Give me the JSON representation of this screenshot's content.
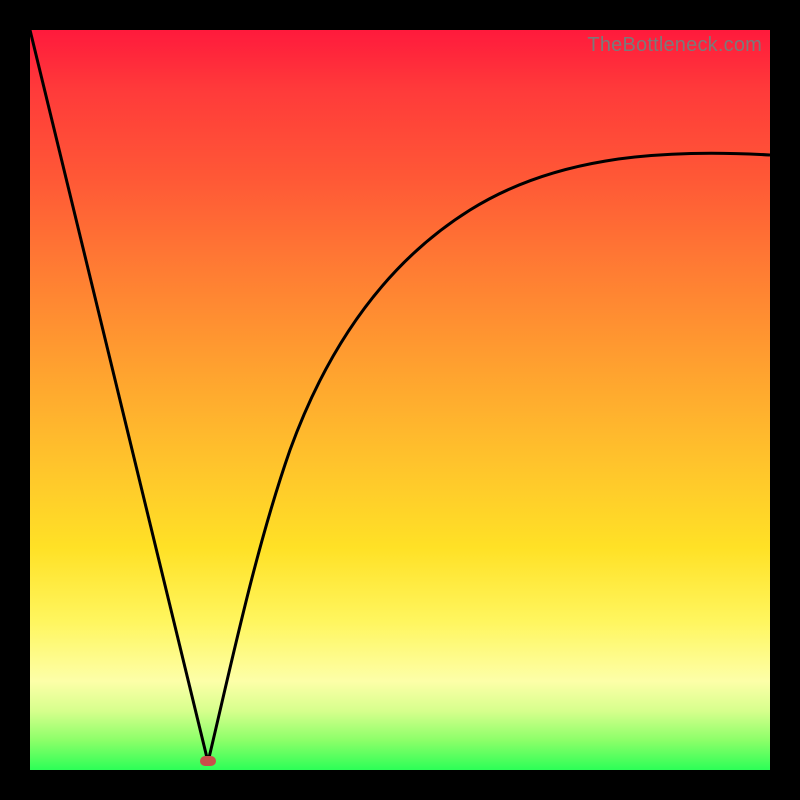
{
  "watermark": "TheBottleneck.com",
  "colors": {
    "frame": "#000000",
    "gradient_top": "#ff1a3c",
    "gradient_bottom": "#2cff57",
    "curve_stroke": "#000000",
    "marker_fill": "#c94f4a"
  },
  "chart_data": {
    "type": "line",
    "title": "",
    "xlabel": "",
    "ylabel": "",
    "xlim": [
      0,
      100
    ],
    "ylim": [
      0,
      100
    ],
    "grid": false,
    "note": "V-shaped bottleneck curve over red→yellow→green vertical gradient. Minimum near x≈24, y≈0. Left branch linear from (0,100) to (24,0). Right branch curved rising toward (100,~83). Tick labels not shown; values estimated from pixel proportions.",
    "series": [
      {
        "name": "left-branch",
        "x": [
          0,
          6,
          12,
          18,
          24
        ],
        "values": [
          100,
          75,
          50,
          25,
          0
        ]
      },
      {
        "name": "right-branch",
        "x": [
          24,
          28,
          32,
          36,
          40,
          46,
          52,
          60,
          70,
          80,
          90,
          100
        ],
        "values": [
          0,
          12,
          24,
          34,
          42,
          51,
          58,
          65,
          72,
          76,
          80,
          83
        ]
      }
    ],
    "marker": {
      "x": 24,
      "y": 0,
      "shape": "pill",
      "color": "#c94f4a"
    },
    "legend": false
  }
}
